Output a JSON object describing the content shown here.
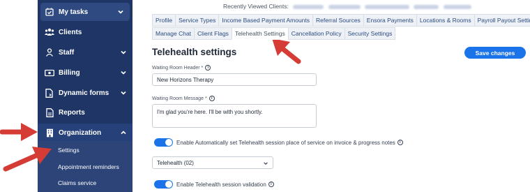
{
  "sidebar": {
    "items": [
      {
        "label": "My tasks",
        "icon": "calendar-check-icon"
      },
      {
        "label": "Clients",
        "icon": "users-icon"
      },
      {
        "label": "Staff",
        "icon": "staff-icon"
      },
      {
        "label": "Billing",
        "icon": "billing-icon"
      },
      {
        "label": "Dynamic forms",
        "icon": "dynamic-forms-icon"
      },
      {
        "label": "Reports",
        "icon": "reports-icon"
      },
      {
        "label": "Organization",
        "icon": "building-icon"
      }
    ],
    "sub_items": [
      "Settings",
      "Appointment reminders",
      "Claims service"
    ]
  },
  "header": {
    "recently_viewed_label": "Recently Viewed Clients:"
  },
  "tabs_row1": [
    "Profile",
    "Service Types",
    "Income Based Payment Amounts",
    "Referral Sources",
    "Ensora Payments",
    "Locations & Rooms",
    "Payroll Payout Settings"
  ],
  "tabs_row2": [
    "Manage Chat",
    "Client Flags",
    "Telehealth Settings",
    "Cancellation Policy",
    "Security Settings"
  ],
  "active_tab": "Telehealth Settings",
  "page": {
    "title": "Telehealth settings",
    "save_label": "Save changes",
    "waiting_header_label": "Waiting Room Header *",
    "waiting_header_value": "New Horizons Therapy",
    "waiting_message_label": "Waiting Room Message *",
    "waiting_message_value": "I'm glad you're here. I'll be with you shortly.",
    "toggle1_label": "Enable Automatically set Telehealth session place of service on invoice & progress notes",
    "select_value": "Telehealth (02)",
    "toggle2_label": "Enable Telehealth session validation",
    "info_glyph": "i"
  },
  "colors": {
    "sidebar_bg": "#1e3566",
    "accent": "#1a73e8",
    "arrow": "#d63c36"
  }
}
